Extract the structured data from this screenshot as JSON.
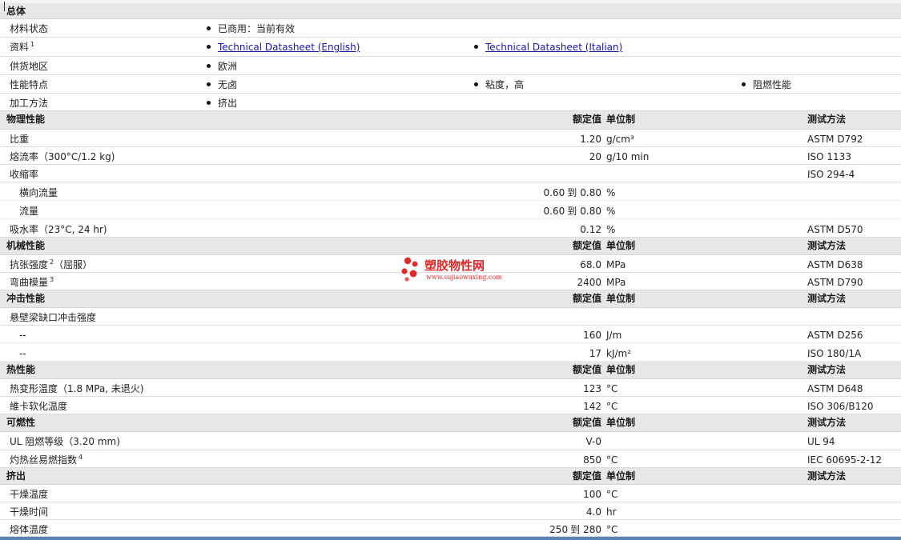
{
  "general": {
    "title": "总体",
    "material_status": {
      "label": "材料状态",
      "value": "已商用：当前有效"
    },
    "documents": {
      "label": "资料",
      "note": "1",
      "links": [
        "Technical Datasheet (English)",
        "Technical Datasheet (Italian)"
      ]
    },
    "availability": {
      "label": "供货地区",
      "value": "欧洲"
    },
    "features": {
      "label": "性能特点",
      "values": [
        "无卤",
        "粘度，高",
        "阻燃性能"
      ]
    },
    "processing": {
      "label": "加工方法",
      "value": "挤出"
    }
  },
  "headers": {
    "nominal": "额定值",
    "unit": "单位制",
    "method": "测试方法"
  },
  "sections": [
    {
      "title": "物理性能",
      "rows": [
        {
          "label": "比重",
          "value": "1.20",
          "unit": "g/cm³",
          "method": "ASTM D792"
        },
        {
          "label": "熔流率（300°C/1.2 kg)",
          "value": "20",
          "unit": "g/10 min",
          "method": "ISO 1133"
        },
        {
          "label": "收缩率",
          "method": "ISO 294-4"
        },
        {
          "label": "横向流量",
          "sub": true,
          "value_from": "0.60",
          "range_word": "到",
          "value_to": "0.80",
          "unit": "%"
        },
        {
          "label": "流量",
          "sub": true,
          "value_from": "0.60",
          "range_word": "到",
          "value_to": "0.80",
          "unit": "%"
        },
        {
          "label": "吸水率（23°C, 24 hr)",
          "value": "0.12",
          "unit": "%",
          "method": "ASTM D570"
        }
      ]
    },
    {
      "title": "机械性能",
      "rows": [
        {
          "label": "抗张强度",
          "note": "2",
          "label_suffix": "（屈服）",
          "value": "68.0",
          "unit": "MPa",
          "method": "ASTM D638"
        },
        {
          "label": "弯曲模量",
          "note": "3",
          "value": "2400",
          "unit": "MPa",
          "method": "ASTM D790"
        }
      ]
    },
    {
      "title": "冲击性能",
      "rows": [
        {
          "label": "悬壁梁缺口冲击强度"
        },
        {
          "label": "--",
          "sub": true,
          "value": "160",
          "unit": "J/m",
          "method": "ASTM D256"
        },
        {
          "label": "--",
          "sub": true,
          "value": "17",
          "unit": "kJ/m²",
          "method": "ISO 180/1A"
        }
      ]
    },
    {
      "title": "热性能",
      "rows": [
        {
          "label": "热变形温度（1.8 MPa, 未退火)",
          "value": "123",
          "unit": "°C",
          "method": "ASTM D648"
        },
        {
          "label": "維卡软化温度",
          "value": "142",
          "unit": "°C",
          "method": "ISO 306/B120"
        }
      ]
    },
    {
      "title": "可燃性",
      "rows": [
        {
          "label": "UL 阻燃等级（3.20 mm)",
          "value": "V-0",
          "method": "UL 94"
        },
        {
          "label": "灼热丝易燃指数",
          "note": "4",
          "value": "850",
          "unit": "°C",
          "method": "IEC 60695-2-12"
        }
      ]
    },
    {
      "title": "挤出",
      "rows": [
        {
          "label": "干燥温度",
          "value": "100",
          "unit": "°C"
        },
        {
          "label": "干燥时间",
          "value": "4.0",
          "unit": "hr"
        },
        {
          "label": "熔体温度",
          "value_from": "250",
          "range_word": "到",
          "value_to": "280",
          "unit": "°C"
        }
      ]
    }
  ],
  "watermark": {
    "text": "塑胶物性网",
    "url": "www.sujiaowuxing.com",
    "color": "#d81e1e"
  },
  "colors": {
    "header_bg": "#e7e7e7",
    "link": "#1a1a9c",
    "bottom_bar": "#5a84b4"
  }
}
